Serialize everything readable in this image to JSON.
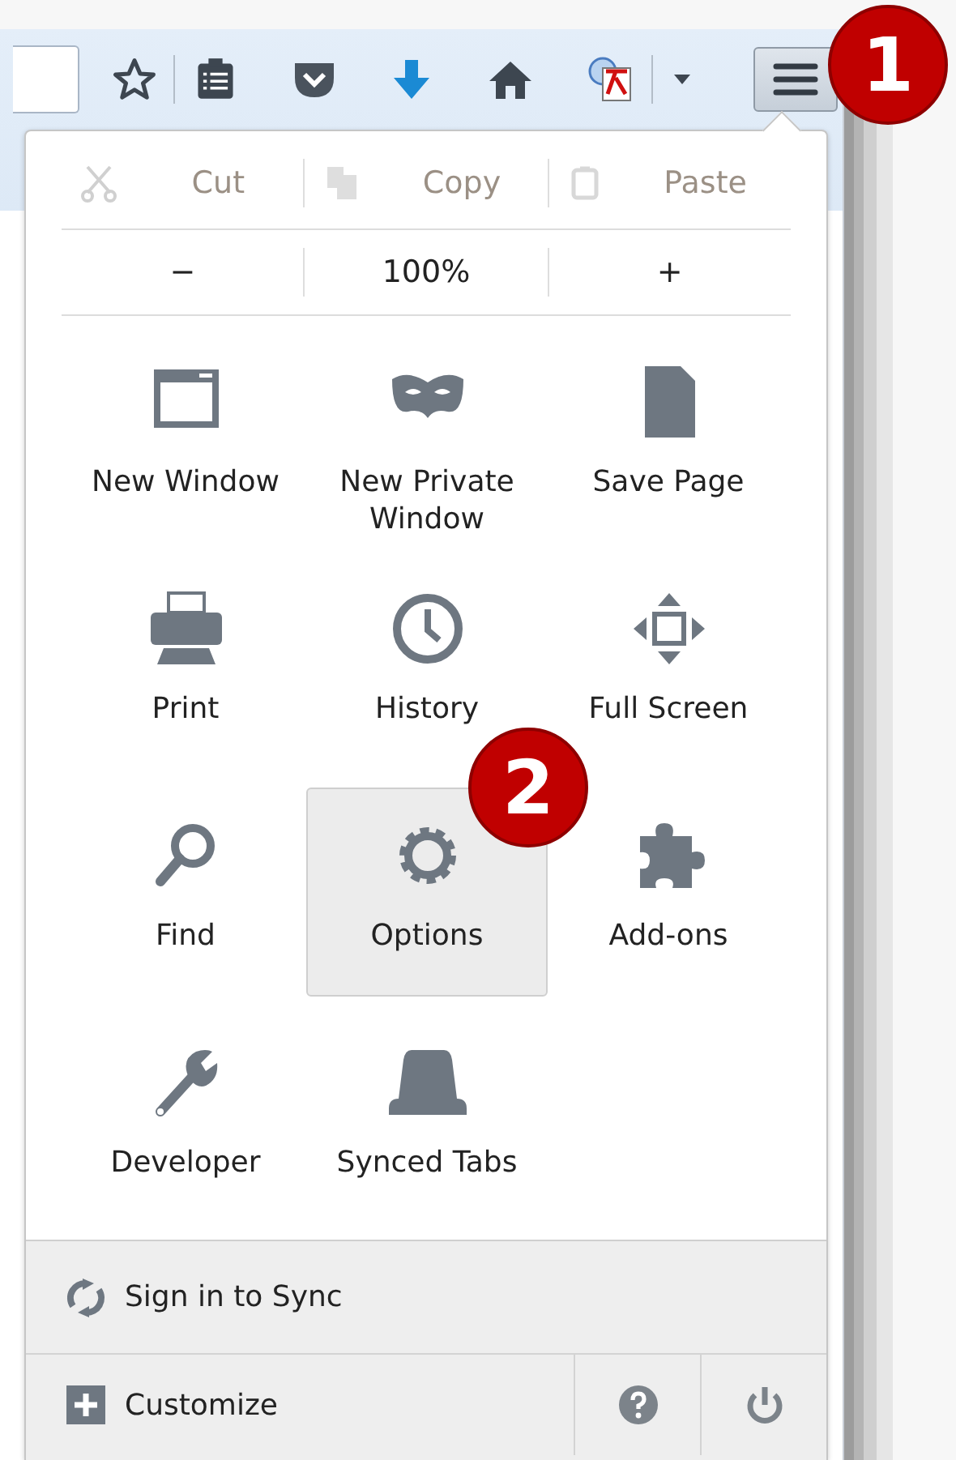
{
  "toolbar": {
    "menu_button": {
      "selected": true
    }
  },
  "edit_row": [
    {
      "kind": "cut",
      "label": "Cut",
      "disabled": true
    },
    {
      "kind": "copy",
      "label": "Copy",
      "disabled": true
    },
    {
      "kind": "paste",
      "label": "Paste",
      "disabled": true
    }
  ],
  "zoom_row": {
    "decrease": "−",
    "level": "100%",
    "increase": "+"
  },
  "items": [
    {
      "kind": "window",
      "label": "New Window",
      "selected": false
    },
    {
      "kind": "mask",
      "label": "New Private Window",
      "selected": false
    },
    {
      "kind": "page",
      "label": "Save Page",
      "selected": false
    },
    {
      "kind": "print",
      "label": "Print",
      "selected": false
    },
    {
      "kind": "clock",
      "label": "History",
      "selected": false
    },
    {
      "kind": "fullscreen",
      "label": "Full Screen",
      "selected": false
    },
    {
      "kind": "search",
      "label": "Find",
      "selected": false
    },
    {
      "kind": "gear",
      "label": "Options",
      "selected": true
    },
    {
      "kind": "puzzle",
      "label": "Add-ons",
      "selected": false
    },
    {
      "kind": "wrench",
      "label": "Developer",
      "selected": false
    },
    {
      "kind": "tabs",
      "label": "Synced Tabs",
      "selected": false
    }
  ],
  "footer": {
    "sign_in": "Sign in to Sync",
    "customize": "Customize"
  },
  "annotations": [
    {
      "label": "1"
    },
    {
      "label": "2"
    }
  ]
}
